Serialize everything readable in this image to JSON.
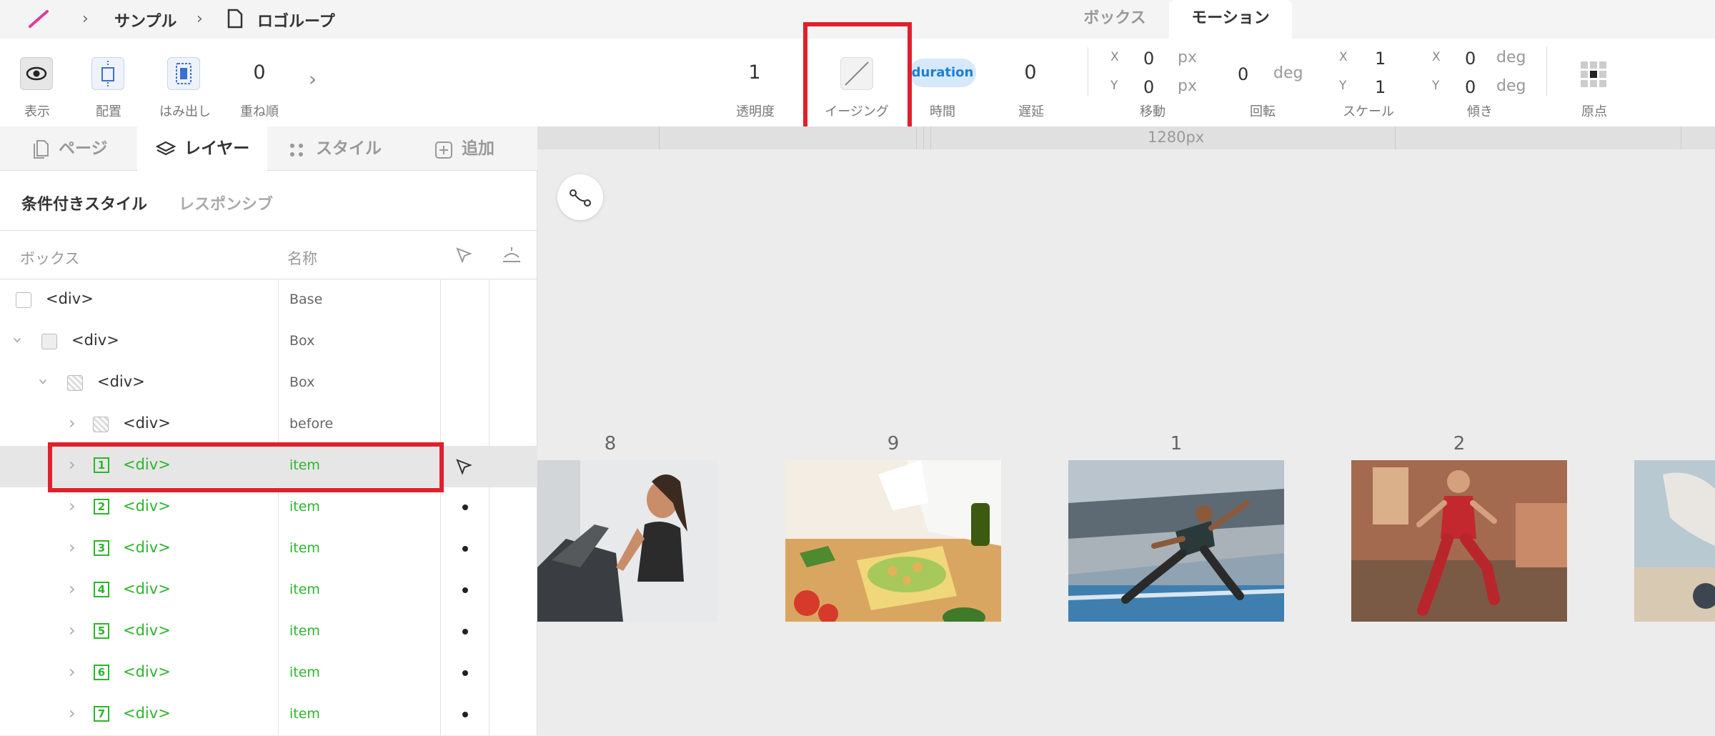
{
  "breadcrumb": {
    "project": "サンプル",
    "page": "ロゴループ"
  },
  "top_tabs": {
    "box": "ボックス",
    "motion": "モーション"
  },
  "toolbar": {
    "view": "表示",
    "align": "配置",
    "overflow": "はみ出し",
    "zindex_value": "0",
    "zindex": "重ね順",
    "opacity_value": "1",
    "opacity": "透明度",
    "easing": "イージング",
    "duration_badge": "duration",
    "duration": "時間",
    "delay_value": "0",
    "delay": "遅延",
    "move": {
      "label": "移動",
      "x_axis": "X",
      "y_axis": "Y",
      "x": "0",
      "y": "0",
      "unit": "px"
    },
    "rotate": {
      "label": "回転",
      "value": "0",
      "unit": "deg"
    },
    "scale": {
      "label": "スケール",
      "x_axis": "X",
      "y_axis": "Y",
      "x": "1",
      "y": "1"
    },
    "skew": {
      "label": "傾き",
      "x_axis": "X",
      "y_axis": "Y",
      "x": "0",
      "y": "0",
      "unit": "deg"
    },
    "origin": "原点"
  },
  "panel_tabs": {
    "pages": "ページ",
    "layers": "レイヤー",
    "styles": "スタイル",
    "add": "追加"
  },
  "sub_tabs": {
    "conditional": "条件付きスタイル",
    "responsive": "レスポンシブ"
  },
  "columns": {
    "box": "ボックス",
    "name": "名称"
  },
  "layers": [
    {
      "tag": "<div>",
      "name": "Base"
    },
    {
      "tag": "<div>",
      "name": "Box"
    },
    {
      "tag": "<div>",
      "name": "Box"
    },
    {
      "tag": "<div>",
      "name": "before"
    },
    {
      "num": "1",
      "tag": "<div>",
      "name": "item"
    },
    {
      "num": "2",
      "tag": "<div>",
      "name": "item"
    },
    {
      "num": "3",
      "tag": "<div>",
      "name": "item"
    },
    {
      "num": "4",
      "tag": "<div>",
      "name": "item"
    },
    {
      "num": "5",
      "tag": "<div>",
      "name": "item"
    },
    {
      "num": "6",
      "tag": "<div>",
      "name": "item"
    },
    {
      "num": "7",
      "tag": "<div>",
      "name": "item"
    }
  ],
  "canvas": {
    "width_label": "1280px",
    "card_numbers": [
      "8",
      "9",
      "1",
      "2"
    ]
  },
  "colors": {
    "highlight": "#e0202a",
    "accent_green": "#2db52d",
    "badge_bg": "#d6e9fb",
    "badge_text": "#1a7fd6"
  }
}
